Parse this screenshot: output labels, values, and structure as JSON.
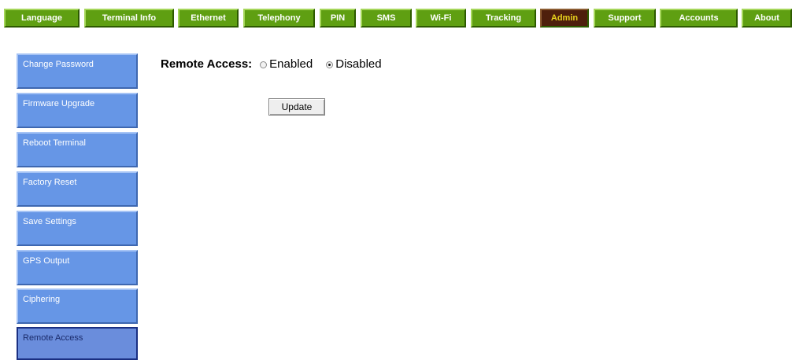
{
  "nav": {
    "tabs": [
      {
        "label": "Language",
        "active": false
      },
      {
        "label": "Terminal Info",
        "active": false
      },
      {
        "label": "Ethernet",
        "active": false
      },
      {
        "label": "Telephony",
        "active": false
      },
      {
        "label": "PIN",
        "active": false
      },
      {
        "label": "SMS",
        "active": false
      },
      {
        "label": "Wi-Fi",
        "active": false
      },
      {
        "label": "Tracking",
        "active": false
      },
      {
        "label": "Admin",
        "active": true
      },
      {
        "label": "Support",
        "active": false
      },
      {
        "label": "Accounts",
        "active": false
      },
      {
        "label": "About",
        "active": false
      }
    ]
  },
  "sidebar": {
    "items": [
      {
        "label": "Change Password",
        "active": false
      },
      {
        "label": "Firmware Upgrade",
        "active": false
      },
      {
        "label": "Reboot Terminal",
        "active": false
      },
      {
        "label": "Factory Reset",
        "active": false
      },
      {
        "label": "Save Settings",
        "active": false
      },
      {
        "label": "GPS Output",
        "active": false
      },
      {
        "label": "Ciphering",
        "active": false
      },
      {
        "label": "Remote Access",
        "active": true
      }
    ]
  },
  "main": {
    "remote_access_label": "Remote Access:",
    "options": [
      {
        "label": "Enabled",
        "checked": false
      },
      {
        "label": "Disabled",
        "checked": true
      }
    ],
    "update_label": "Update"
  },
  "colors": {
    "tab_bg": "#5f9f12",
    "tab_active_bg": "#4e1f0c",
    "tab_active_text": "#e7d21d",
    "sidebar_bg": "#6696e6",
    "sidebar_active_border": "#1a2f82"
  }
}
